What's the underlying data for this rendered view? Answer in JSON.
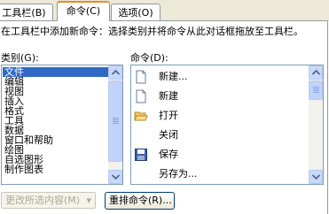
{
  "tabs": [
    {
      "label": "工具栏(B)"
    },
    {
      "label": "命令(C)"
    },
    {
      "label": "选项(O)"
    }
  ],
  "description": "在工具栏中添加新命令：选择类别并将命令从此对话框拖放至工具栏。",
  "categories_label": "类别(G):",
  "commands_label": "命令(D):",
  "categories": [
    "文件",
    "编辑",
    "视图",
    "插入",
    "格式",
    "工具",
    "数据",
    "窗口和帮助",
    "绘图",
    "自选图形",
    "制作图表"
  ],
  "selected_category": "文件",
  "commands": [
    {
      "label": "新建...",
      "icon": "new-document-icon"
    },
    {
      "label": "新建",
      "icon": "new-document-icon"
    },
    {
      "label": "打开",
      "icon": "open-folder-icon"
    },
    {
      "label": "关闭",
      "icon": ""
    },
    {
      "label": "保存",
      "icon": "save-disk-icon"
    },
    {
      "label": "另存为...",
      "icon": ""
    }
  ],
  "modify_selection_button": "更改所选内容(M)",
  "rearrange_button": "重排命令(R)..."
}
